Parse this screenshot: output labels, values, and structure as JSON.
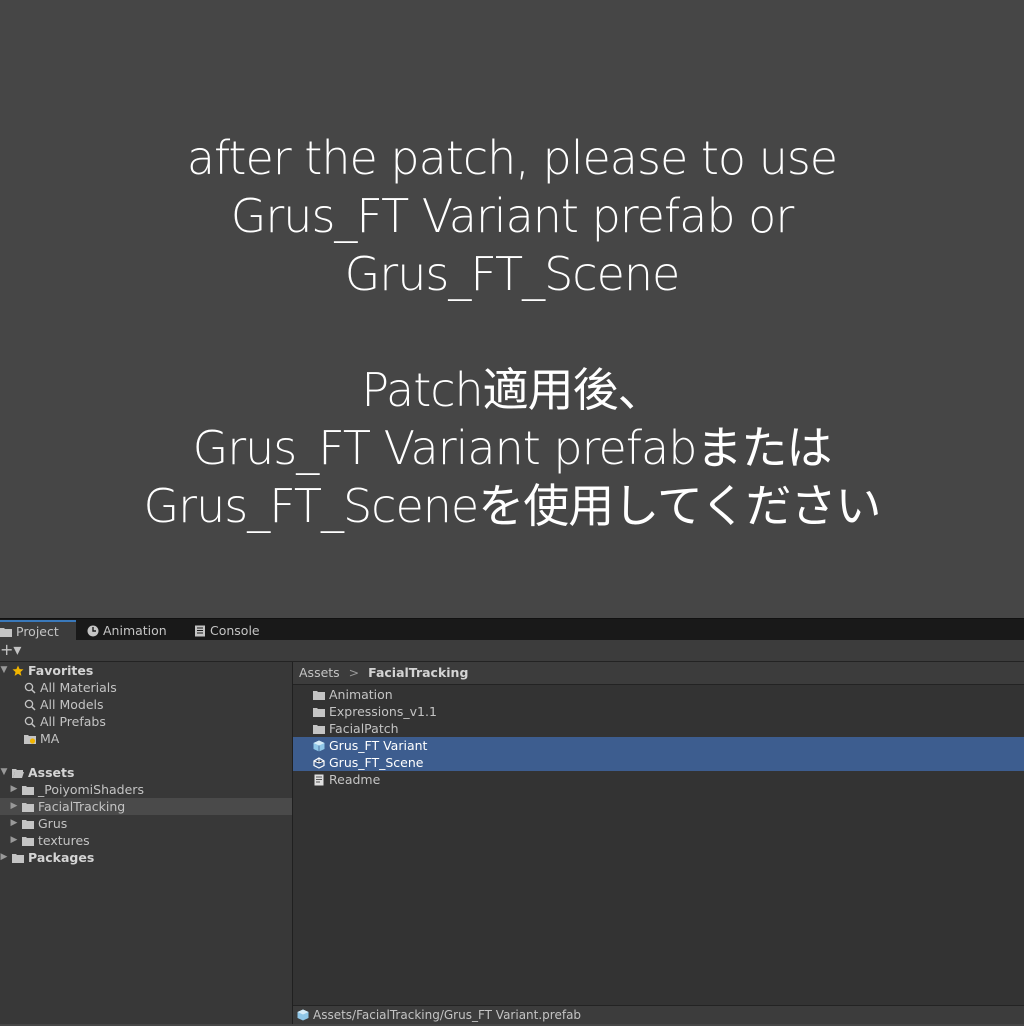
{
  "instruction": {
    "line1": "after the patch, please to use",
    "line2": "Grus_FT Variant prefab or",
    "line3": "Grus_FT_Scene",
    "line4": "Patch適用後、",
    "line5": "Grus_FT Variant prefabまたは",
    "line6": "Grus_FT_Sceneを使用してください"
  },
  "tabs": [
    {
      "label": "Project",
      "icon": "folder-icon"
    },
    {
      "label": "Animation",
      "icon": "clock-icon"
    },
    {
      "label": "Console",
      "icon": "console-icon"
    }
  ],
  "toolbar": {
    "add_label": "+▾"
  },
  "tree": {
    "favorites": {
      "label": "Favorites",
      "items": [
        "All Materials",
        "All Models",
        "All Prefabs",
        "MA"
      ]
    },
    "assets": {
      "label": "Assets",
      "items": [
        "_PoiyomiShaders",
        "FacialTracking",
        "Grus",
        "textures"
      ]
    },
    "packages": {
      "label": "Packages"
    }
  },
  "breadcrumb": {
    "root": "Assets",
    "separator": ">",
    "current": "FacialTracking"
  },
  "files": [
    {
      "name": "Animation",
      "icon": "folder-icon"
    },
    {
      "name": "Expressions_v1.1",
      "icon": "folder-icon"
    },
    {
      "name": "FacialPatch",
      "icon": "folder-icon"
    },
    {
      "name": "Grus_FT Variant",
      "icon": "prefab-variant-icon"
    },
    {
      "name": "Grus_FT_Scene",
      "icon": "unity-scene-icon"
    },
    {
      "name": "Readme",
      "icon": "document-icon"
    }
  ],
  "status": {
    "path": "Assets/FacialTracking/Grus_FT Variant.prefab"
  },
  "colors": {
    "selection": "#3d5d8f",
    "tab_accent": "#3a79bb",
    "star": "#f0b400"
  }
}
